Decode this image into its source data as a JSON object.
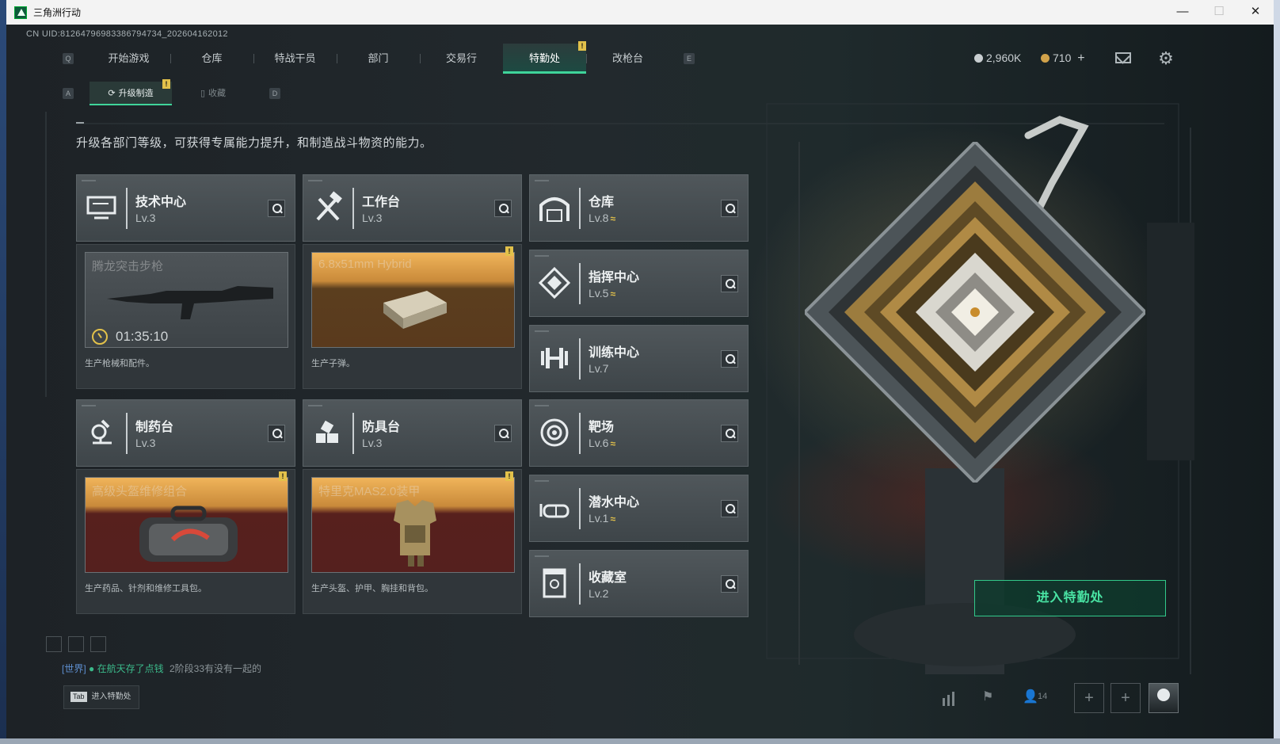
{
  "window": {
    "title": "三角洲行动",
    "minimize": "—",
    "maximize": "☐",
    "close": "✕"
  },
  "uid": "CN UID:8126479698338679473​4_202604162012",
  "hotkeys": {
    "nav_left": "Q",
    "nav_right": "E",
    "sub_left": "A",
    "sub_right": "D"
  },
  "nav": {
    "tabs": [
      "开始游戏",
      "仓库",
      "特战干员",
      "部门",
      "交易行",
      "特勤处",
      "改枪台"
    ],
    "active": "特勤处",
    "badge": "!"
  },
  "currency": {
    "coins": "2,960K",
    "gold": "710",
    "gold_add": "+"
  },
  "subnav": {
    "tabs": [
      "升级制造",
      "收藏"
    ],
    "active": "升级制造",
    "badge": "!"
  },
  "description": "升级各部门等级，可获得专属能力提升，和制造战斗物资的能力。",
  "departments": [
    {
      "name": "技术中心",
      "level": "Lv.3",
      "upgradable": false,
      "icon": "monitor-icon"
    },
    {
      "name": "工作台",
      "level": "Lv.3",
      "upgradable": false,
      "icon": "hammer-wrench-icon"
    },
    {
      "name": "仓库",
      "level": "Lv.8",
      "upgradable": true,
      "icon": "warehouse-icon"
    },
    {
      "name": "指挥中心",
      "level": "Lv.5",
      "upgradable": true,
      "icon": "command-center-icon"
    },
    {
      "name": "训练中心",
      "level": "Lv.7",
      "upgradable": false,
      "icon": "dumbbell-icon"
    },
    {
      "name": "制药台",
      "level": "Lv.3",
      "upgradable": false,
      "icon": "microscope-icon"
    },
    {
      "name": "防具台",
      "level": "Lv.3",
      "upgradable": false,
      "icon": "armor-parts-icon"
    },
    {
      "name": "靶场",
      "level": "Lv.6",
      "upgradable": true,
      "icon": "target-icon"
    },
    {
      "name": "潜水中心",
      "level": "Lv.1",
      "upgradable": true,
      "icon": "diving-mask-icon"
    },
    {
      "name": "收藏室",
      "level": "Lv.2",
      "upgradable": false,
      "icon": "display-case-icon"
    }
  ],
  "upgrade_glyph": "≈",
  "production": [
    {
      "item": "腾龙突击步枪",
      "caption": "生产枪械和配件。",
      "timer": "01:35:10",
      "ready": false
    },
    {
      "item": "6.8x51mm Hybrid",
      "caption": "生产子弹。",
      "ready": true
    },
    {
      "item": "高级头盔维修组合",
      "caption": "生产药品、针剂和维修工具包。",
      "ready": true
    },
    {
      "item": "特里克MAS2.0装甲",
      "caption": "生产头盔、护甲、胸挂和背包。",
      "ready": true
    }
  ],
  "enter_button": "进入特勤处",
  "chat": {
    "channel": "[世界]",
    "sender": "在航天存了点钱",
    "message": "2阶段33有没有一起的"
  },
  "tab_hint": {
    "key": "Tab",
    "label": "进入特勤处"
  },
  "footer": {
    "friends_count": "14",
    "add": "+"
  },
  "colors": {
    "accent": "#3fd49a",
    "badge": "#e2c14a",
    "ready_gold": "#f0b45a"
  }
}
